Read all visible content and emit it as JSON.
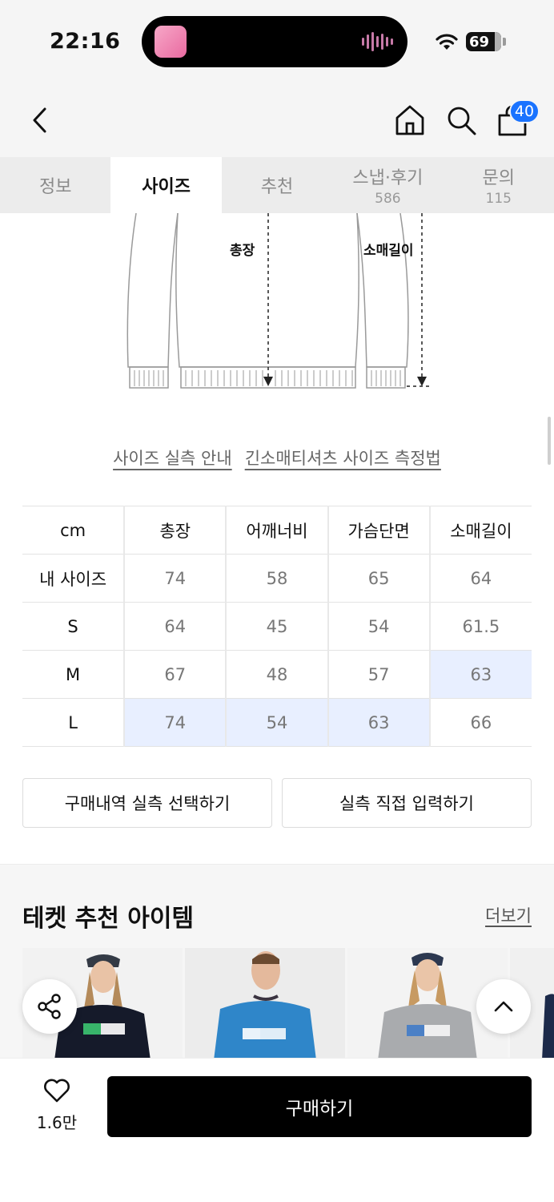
{
  "status_bar": {
    "time": "22:16",
    "battery": "69"
  },
  "nav": {
    "cart_count": "40"
  },
  "tabs": [
    {
      "label": "정보",
      "count": ""
    },
    {
      "label": "사이즈",
      "count": ""
    },
    {
      "label": "추천",
      "count": ""
    },
    {
      "label": "스냅·후기",
      "count": "586"
    },
    {
      "label": "문의",
      "count": "115"
    }
  ],
  "diagram": {
    "length_label": "총장",
    "sleeve_label": "소매길이"
  },
  "links": {
    "guide": "사이즈 실측 안내",
    "method": "긴소매티셔츠 사이즈 측정법"
  },
  "size_table": {
    "headers": [
      "cm",
      "총장",
      "어깨너비",
      "가슴단면",
      "소매길이"
    ],
    "rows": [
      {
        "label": "내 사이즈",
        "values": [
          "74",
          "58",
          "65",
          "64"
        ]
      },
      {
        "label": "S",
        "values": [
          "64",
          "45",
          "54",
          "61.5"
        ]
      },
      {
        "label": "M",
        "values": [
          "67",
          "48",
          "57",
          "63"
        ]
      },
      {
        "label": "L",
        "values": [
          "74",
          "54",
          "63",
          "66"
        ]
      }
    ]
  },
  "buttons": {
    "history": "구매내역 실측 선택하기",
    "manual": "실측 직접 입력하기"
  },
  "recommend": {
    "title": "테켓 추천 아이템",
    "more": "더보기"
  },
  "bottom": {
    "like_count": "1.6만",
    "buy_label": "구매하기"
  },
  "colors": {
    "accent_blue": "#1a73ff",
    "highlight": "#e8efff"
  }
}
